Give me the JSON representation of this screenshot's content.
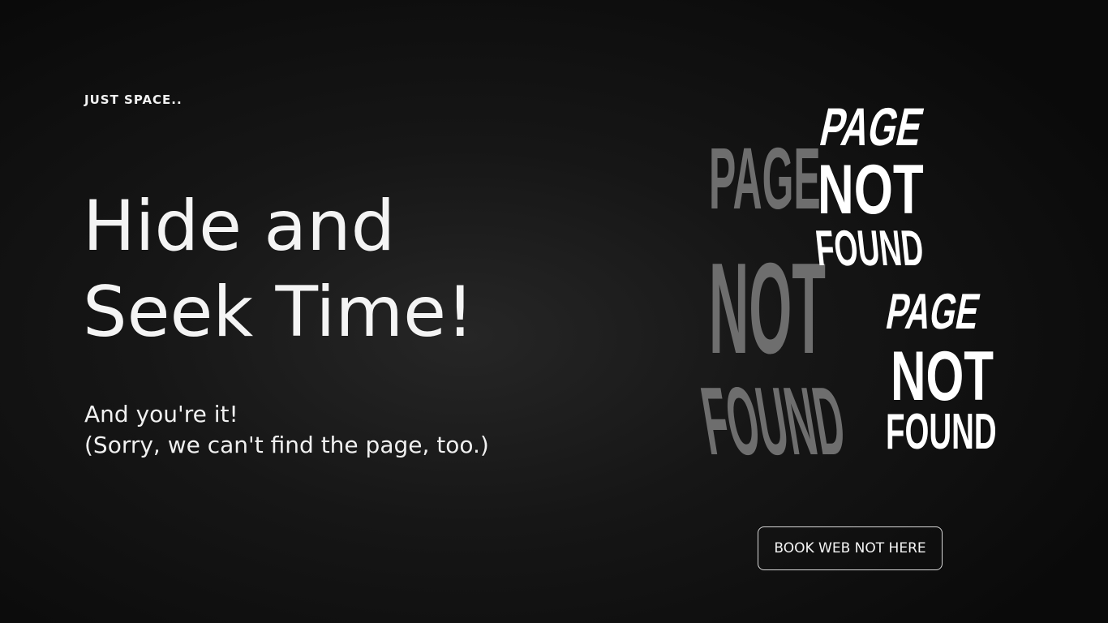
{
  "brand": {
    "label": "JUST SPACE.."
  },
  "headline": {
    "line1": "Hide and",
    "line2": "Seek Time!"
  },
  "subtext": {
    "line1": "And you're it!",
    "line2": "(Sorry, we can't find the page, too.)"
  },
  "illustration": {
    "word1": "PAGE",
    "word2": "NOT",
    "word3": "FOUND",
    "colors": {
      "shadow": "#6e6e6e",
      "front": "#ffffff"
    }
  },
  "cta": {
    "label": "BOOK WEB NOT HERE"
  }
}
